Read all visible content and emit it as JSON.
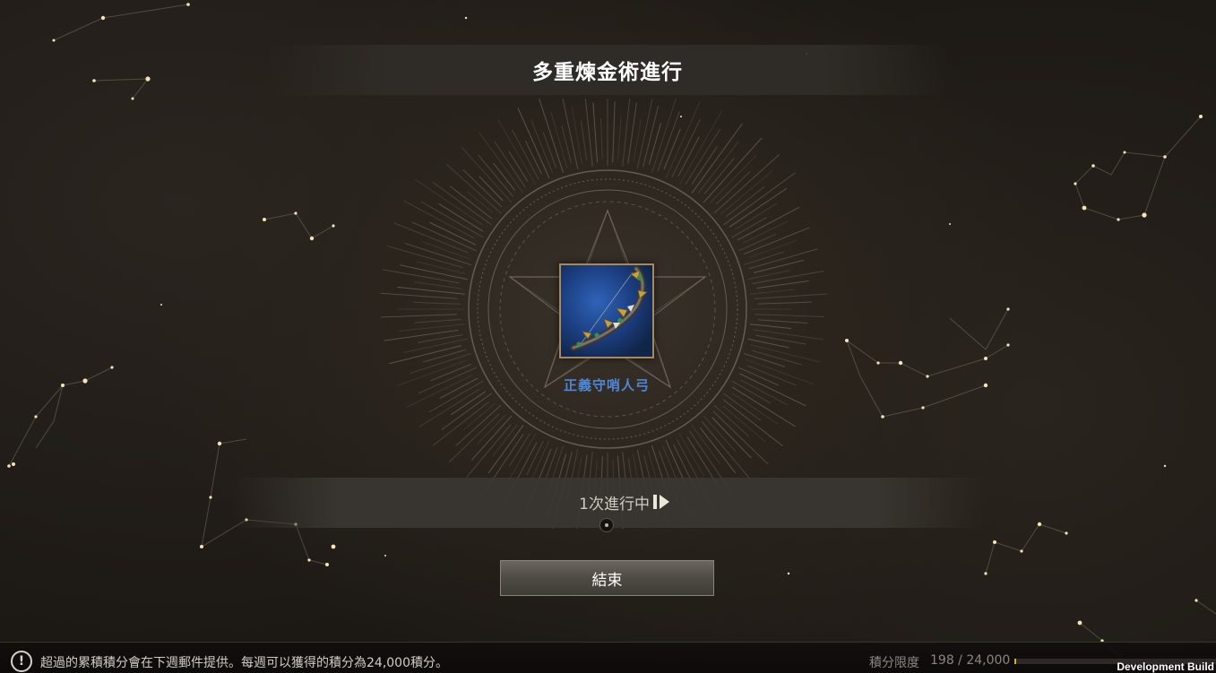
{
  "header": {
    "title": "多重煉金術進行"
  },
  "item": {
    "name": "正義守哨人弓",
    "icon": "bow-icon"
  },
  "progress": {
    "status": "1次進行中",
    "skip_icon": "fast-forward-icon"
  },
  "actions": {
    "end_label": "結束"
  },
  "footer": {
    "notice_icon": "exclamation-icon",
    "notice": "超過的累積積分會在下週郵件提供。每週可以獲得的積分為24,000積分。",
    "points_label": "積分限度",
    "points_value": "198 / 24,000",
    "points_current": 198,
    "points_max": 24000
  },
  "watermark": "Development Build",
  "colors": {
    "item_name": "#4f86d6",
    "points_fill": "#e0a52c",
    "item_bg": "#2f63b8"
  }
}
